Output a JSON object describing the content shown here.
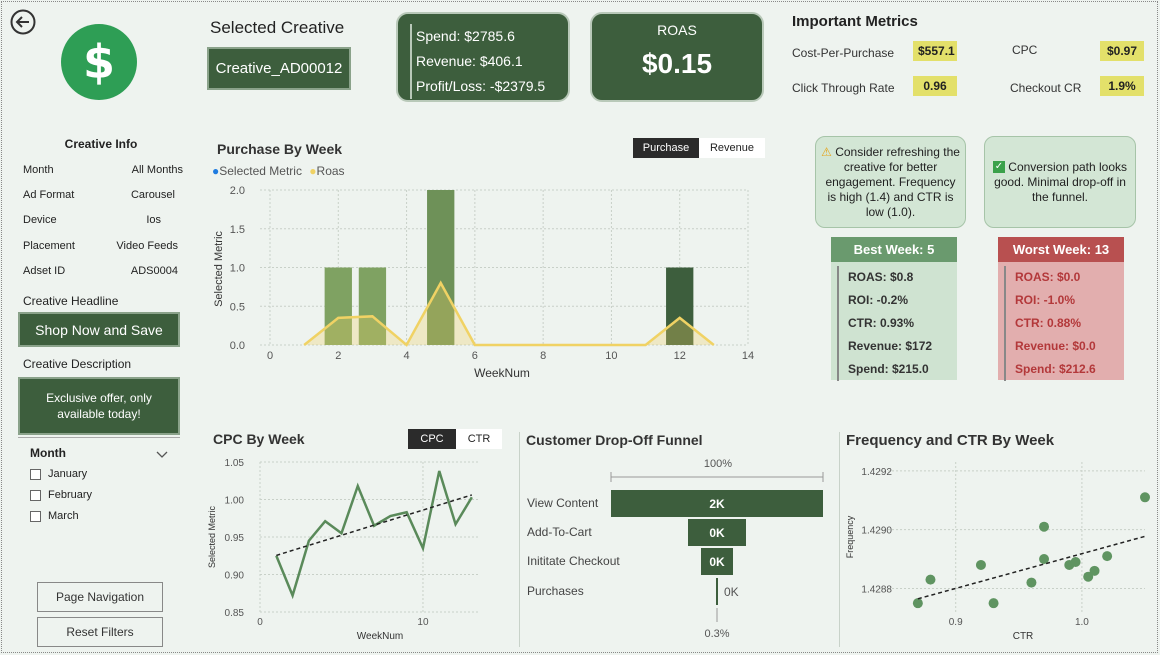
{
  "header": {
    "selected_creative_title": "Selected Creative",
    "selected_creative": "Creative_AD00012",
    "spend": "Spend: $2785.6",
    "revenue": "Revenue: $406.1",
    "profit": "Profit/Loss: -$2379.5",
    "roas_label": "ROAS",
    "roas_value": "$0.15"
  },
  "important_metrics": {
    "title": "Important Metrics",
    "cpp_label": "Cost-Per-Purchase",
    "cpp_value": "$557.1",
    "cpc_label": "CPC",
    "cpc_value": "$0.97",
    "ctr_label": "Click Through Rate",
    "ctr_value": "0.96",
    "checkout_label": "Checkout CR",
    "checkout_value": "1.9%"
  },
  "creative_info": {
    "title": "Creative Info",
    "rows": [
      {
        "label": "Month",
        "value": "All Months"
      },
      {
        "label": "Ad Format",
        "value": "Carousel"
      },
      {
        "label": "Device",
        "value": "Ios"
      },
      {
        "label": "Placement",
        "value": "Video Feeds"
      },
      {
        "label": "Adset ID",
        "value": "ADS0004"
      }
    ],
    "headline_label": "Creative Headline",
    "headline": "Shop Now and Save",
    "description_label": "Creative Description",
    "description": "Exclusive offer, only available today!"
  },
  "month_slicer": {
    "title": "Month",
    "options": [
      "January",
      "February",
      "March"
    ]
  },
  "buttons": {
    "page_navigation": "Page Navigation",
    "reset_filters": "Reset Filters"
  },
  "purchase_chart": {
    "title": "Purchase By Week",
    "toggle_on": "Purchase",
    "toggle_off": "Revenue",
    "legend_1": "Selected Metric",
    "legend_2": "Roas",
    "xlabel": "WeekNum",
    "ylabel": "Selected Metric",
    "yticks": [
      "2.0",
      "1.5",
      "1.0",
      "0.5",
      "0.0"
    ],
    "xticks": [
      "0",
      "2",
      "4",
      "6",
      "8",
      "10",
      "12",
      "14"
    ]
  },
  "cpc_chart": {
    "title": "CPC By Week",
    "toggle_on": "CPC",
    "toggle_off": "CTR",
    "xlabel": "WeekNum",
    "ylabel": "Selected Metric",
    "yticks": [
      "1.05",
      "1.00",
      "0.95",
      "0.90",
      "0.85"
    ],
    "xticks": [
      "0",
      "10"
    ]
  },
  "funnel": {
    "title": "Customer Drop-Off Funnel",
    "top_pct": "100%",
    "bottom_pct": "0.3%",
    "stages": [
      {
        "label": "View Content",
        "value": "2K"
      },
      {
        "label": "Add-To-Cart",
        "value": "0K"
      },
      {
        "label": "Inititate Checkout",
        "value": "0K"
      },
      {
        "label": "Purchases",
        "value": "0K"
      }
    ]
  },
  "freq_chart": {
    "title": "Frequency and CTR By Week",
    "xlabel": "CTR",
    "ylabel": "Frequency",
    "yticks": [
      "1.4292",
      "1.4290",
      "1.4288"
    ],
    "xticks": [
      "0.9",
      "1.0"
    ]
  },
  "alerts": {
    "refresh": "Consider refreshing the creative for better engagement. Frequency is high (1.4) and CTR is low (1.0).",
    "conversion": "Conversion path looks good. Minimal drop-off in the funnel."
  },
  "best_week": {
    "title": "Best Week: 5",
    "lines": [
      "ROAS: $0.8",
      "ROI: -0.2%",
      "CTR: 0.93%",
      "Revenue: $172",
      "Spend: $215.0"
    ]
  },
  "worst_week": {
    "title": "Worst Week: 13",
    "lines": [
      "ROAS: $0.0",
      "ROI: -1.0%",
      "CTR: 0.88%",
      "Revenue: $0.0",
      "Spend: $212.6"
    ]
  },
  "colors": {
    "dark_green": "#3d5e3d",
    "bar_green": "#7fa262",
    "roas_yellow": "#f0d264",
    "best": "#6a9a6e",
    "worst": "#b85050"
  },
  "chart_data": [
    {
      "type": "bar",
      "title": "Purchase By Week",
      "xlabel": "WeekNum",
      "ylabel": "Selected Metric",
      "xlim": [
        0,
        14
      ],
      "ylim": [
        0,
        2
      ],
      "series": [
        {
          "name": "Selected Metric",
          "x": [
            2,
            3,
            5,
            12
          ],
          "values": [
            1,
            1,
            2,
            1
          ]
        },
        {
          "name": "Roas",
          "x": [
            1,
            2,
            3,
            4,
            5,
            6,
            7,
            8,
            9,
            10,
            11,
            12,
            13
          ],
          "values": [
            0,
            0.35,
            0.37,
            0,
            0.8,
            0,
            0,
            0,
            0,
            0,
            0,
            0.35,
            0
          ]
        }
      ]
    },
    {
      "type": "line",
      "title": "CPC By Week",
      "xlabel": "WeekNum",
      "ylabel": "Selected Metric",
      "ylim": [
        0.85,
        1.05
      ],
      "x": [
        1,
        2,
        3,
        4,
        5,
        6,
        7,
        8,
        9,
        10,
        11,
        12,
        13
      ],
      "values": [
        0.925,
        0.872,
        0.945,
        0.971,
        0.955,
        1.018,
        0.965,
        0.978,
        0.983,
        0.935,
        1.038,
        0.967,
        1.003
      ]
    },
    {
      "type": "scatter",
      "title": "Frequency and CTR By Week",
      "xlabel": "CTR",
      "ylabel": "Frequency",
      "xlim": [
        0.84,
        1.05
      ],
      "ylim": [
        1.42872,
        1.42923
      ],
      "x": [
        0.87,
        0.88,
        0.93,
        0.92,
        0.96,
        0.97,
        0.97,
        0.99,
        0.995,
        1.01,
        1.005,
        1.02,
        1.05
      ],
      "values": [
        1.42875,
        1.42883,
        1.42875,
        1.42888,
        1.42882,
        1.4289,
        1.42901,
        1.42888,
        1.42889,
        1.42886,
        1.42884,
        1.42891,
        1.42911
      ]
    }
  ]
}
